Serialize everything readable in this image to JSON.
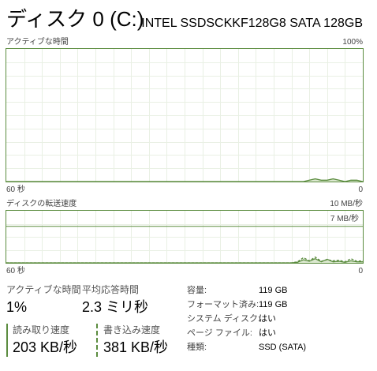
{
  "header": {
    "title": "ディスク 0 (C:)",
    "model": "INTEL SSDSCKKF128G8 SATA 128GB"
  },
  "active_time_graph": {
    "label": "アクティブな時間",
    "max_label": "100%",
    "left_axis": "60 秒",
    "right_axis": "0",
    "values": [
      0,
      0,
      0,
      0,
      0,
      0,
      0,
      0,
      0,
      0,
      0,
      0,
      0,
      0,
      0,
      0,
      0,
      0,
      0,
      0,
      0,
      0,
      0,
      0,
      0,
      0,
      0,
      0,
      0,
      0,
      0,
      0,
      0,
      0,
      0,
      0,
      0,
      0,
      0,
      0,
      0,
      0,
      0,
      0,
      0,
      0,
      0,
      0,
      0,
      0,
      0,
      1,
      2,
      1,
      1,
      2,
      1,
      0,
      1,
      1,
      0
    ]
  },
  "transfer_graph": {
    "label": "ディスクの転送速度",
    "max_label": "10 MB/秒",
    "scale_line_label": "7 MB/秒",
    "scale_line_value": 7,
    "max_value": 10,
    "left_axis": "60 秒",
    "right_axis": "0",
    "read_values": [
      0,
      0,
      0,
      0,
      0,
      0,
      0,
      0,
      0,
      0,
      0,
      0,
      0,
      0,
      0,
      0,
      0,
      0,
      0,
      0,
      0,
      0,
      0,
      0,
      0,
      0,
      0,
      0,
      0,
      0,
      0,
      0,
      0,
      0,
      0,
      0,
      0,
      0,
      0,
      0,
      0,
      0,
      0,
      0,
      0,
      0,
      0,
      0,
      0,
      0.1,
      0.6,
      0.3,
      0.8,
      0.2,
      0.7,
      0.2,
      0.3,
      0.1,
      0.4,
      0.2,
      0.2
    ],
    "write_values": [
      0,
      0,
      0,
      0,
      0,
      0,
      0,
      0,
      0,
      0,
      0,
      0,
      0,
      0,
      0,
      0,
      0,
      0,
      0,
      0,
      0,
      0,
      0,
      0,
      0,
      0,
      0,
      0,
      0,
      0,
      0,
      0,
      0,
      0,
      0,
      0,
      0,
      0,
      0,
      0,
      0,
      0,
      0,
      0,
      0,
      0,
      0,
      0,
      0,
      0.2,
      1.0,
      0.4,
      1.1,
      0.3,
      0.6,
      0.4,
      0.5,
      0.2,
      0.8,
      0.3,
      0.4
    ],
    "color": "#5b8c3f"
  },
  "stats": {
    "active_time_label": "アクティブな時間",
    "active_time_value": "1%",
    "response_label": "平均応答時間",
    "response_value": "2.3 ミリ秒",
    "read_label": "読み取り速度",
    "read_value": "203 KB/秒",
    "write_label": "書き込み速度",
    "write_value": "381 KB/秒"
  },
  "info": {
    "capacity_label": "容量:",
    "capacity_value": "119 GB",
    "formatted_label": "フォーマット済み:",
    "formatted_value": "119 GB",
    "system_disk_label": "システム ディスク:",
    "system_disk_value": "はい",
    "page_file_label": "ページ ファイル:",
    "page_file_value": "はい",
    "type_label": "種類:",
    "type_value": "SSD (SATA)"
  }
}
